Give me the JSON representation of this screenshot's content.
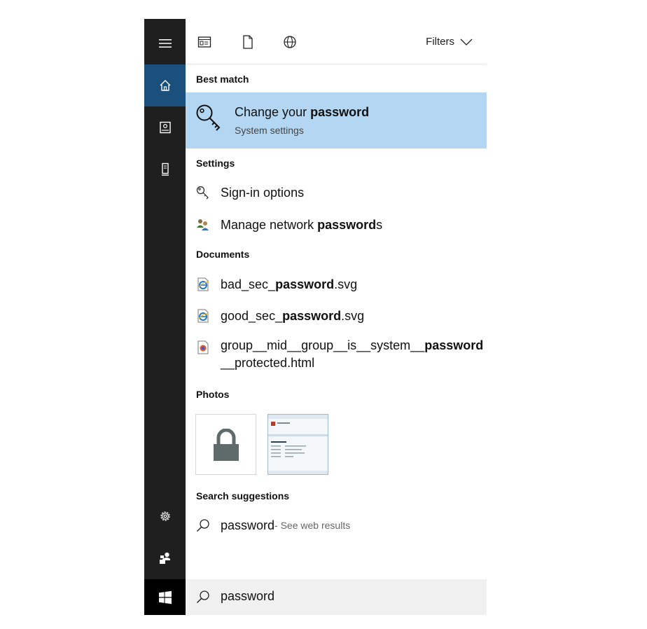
{
  "toolbar": {
    "filters_label": "Filters"
  },
  "sections": {
    "best_match": "Best match",
    "settings": "Settings",
    "documents": "Documents",
    "photos": "Photos",
    "search_suggestions": "Search suggestions"
  },
  "best_match": {
    "title_prefix": "Change your ",
    "title_bold": "password",
    "subtitle": "System settings"
  },
  "settings_items": [
    {
      "label": "Sign-in options"
    },
    {
      "prefix": "Manage network ",
      "bold": "password",
      "suffix": "s"
    }
  ],
  "documents": [
    {
      "prefix": "bad_sec_",
      "bold": "password",
      "suffix": ".svg"
    },
    {
      "prefix": "good_sec_",
      "bold": "password",
      "suffix": ".svg"
    },
    {
      "prefix": "group__mid__group__is__system__",
      "bold": "password",
      "line2": "__protected.html"
    }
  ],
  "suggestion": {
    "term": "password",
    "hint": " - See web results"
  },
  "search": {
    "query": "password"
  },
  "colors": {
    "rail": "#1f1f1f",
    "rail_selected": "#1b4f7c",
    "best_match_bg": "#b3d7f3",
    "search_bg": "#f0f0f0"
  },
  "icons": {
    "rail": [
      "hamburger-icon",
      "home-icon",
      "notebook-icon",
      "device-icon",
      "gear-icon",
      "feedback-icon",
      "windows-icon"
    ],
    "toolbar": [
      "apps-icon",
      "document-icon",
      "web-icon",
      "chevron-down-icon"
    ]
  }
}
